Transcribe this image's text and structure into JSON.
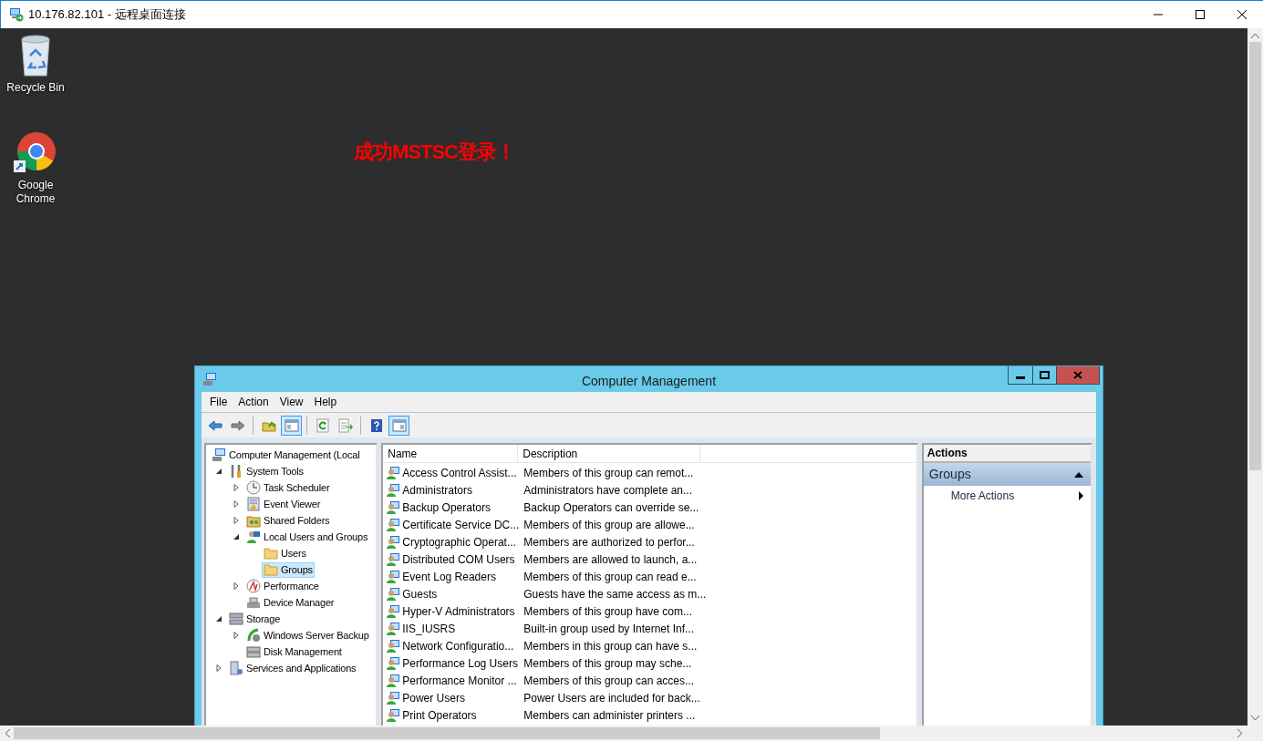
{
  "rdp_window": {
    "title": "10.176.82.101 - 远程桌面连接"
  },
  "desktop": {
    "icons": [
      {
        "label": "Recycle Bin"
      },
      {
        "label": "Google Chrome"
      }
    ],
    "banner": "成功MSTSC登录！"
  },
  "computer_management": {
    "title": "Computer Management",
    "menu": [
      "File",
      "Action",
      "View",
      "Help"
    ],
    "toolbar": [
      {
        "pressed": false
      },
      {
        "pressed": false
      },
      {
        "pressed": false
      },
      {
        "pressed": true
      },
      {
        "pressed": false
      },
      {
        "pressed": false
      },
      {
        "pressed": false
      },
      {
        "pressed": true
      }
    ],
    "tree": [
      {
        "label": "Computer Management (Local",
        "selected": false,
        "children": [
          {
            "label": "System Tools",
            "expanded": true,
            "selected": false,
            "children": [
              {
                "label": "Task Scheduler",
                "expanded": false,
                "selected": false
              },
              {
                "label": "Event Viewer",
                "expanded": false,
                "selected": false
              },
              {
                "label": "Shared Folders",
                "expanded": false,
                "selected": false
              },
              {
                "label": "Local Users and Groups",
                "expanded": true,
                "selected": false,
                "children": [
                  {
                    "label": "Users",
                    "selected": false
                  },
                  {
                    "label": "Groups",
                    "selected": true
                  }
                ]
              },
              {
                "label": "Performance",
                "expanded": false,
                "selected": false
              },
              {
                "label": "Device Manager",
                "selected": false
              }
            ]
          },
          {
            "label": "Storage",
            "expanded": true,
            "selected": false,
            "children": [
              {
                "label": "Windows Server Backup",
                "expanded": false,
                "selected": false
              },
              {
                "label": "Disk Management",
                "selected": false
              }
            ]
          },
          {
            "label": "Services and Applications",
            "expanded": false,
            "selected": false
          }
        ]
      }
    ],
    "columns": [
      "Name",
      "Description"
    ],
    "rows": [
      {
        "name": "Access Control Assist...",
        "description": "Members of this group can remot..."
      },
      {
        "name": "Administrators",
        "description": "Administrators have complete an..."
      },
      {
        "name": "Backup Operators",
        "description": "Backup Operators can override se..."
      },
      {
        "name": "Certificate Service DC...",
        "description": "Members of this group are allowe..."
      },
      {
        "name": "Cryptographic Operat...",
        "description": "Members are authorized to perfor..."
      },
      {
        "name": "Distributed COM Users",
        "description": "Members are allowed to launch, a..."
      },
      {
        "name": "Event Log Readers",
        "description": "Members of this group can read e..."
      },
      {
        "name": "Guests",
        "description": "Guests have the same access as m..."
      },
      {
        "name": "Hyper-V Administrators",
        "description": "Members of this group have com..."
      },
      {
        "name": "IIS_IUSRS",
        "description": "Built-in group used by Internet Inf..."
      },
      {
        "name": "Network Configuratio...",
        "description": "Members in this group can have s..."
      },
      {
        "name": "Performance Log Users",
        "description": "Members of this group may sche..."
      },
      {
        "name": "Performance Monitor ...",
        "description": "Members of this group can acces..."
      },
      {
        "name": "Power Users",
        "description": "Power Users are included for back..."
      },
      {
        "name": "Print Operators",
        "description": "Members can administer printers ..."
      }
    ],
    "actions": {
      "header": "Actions",
      "section": {
        "label": "Groups",
        "expanded": true
      },
      "items": [
        "More Actions"
      ]
    }
  }
}
